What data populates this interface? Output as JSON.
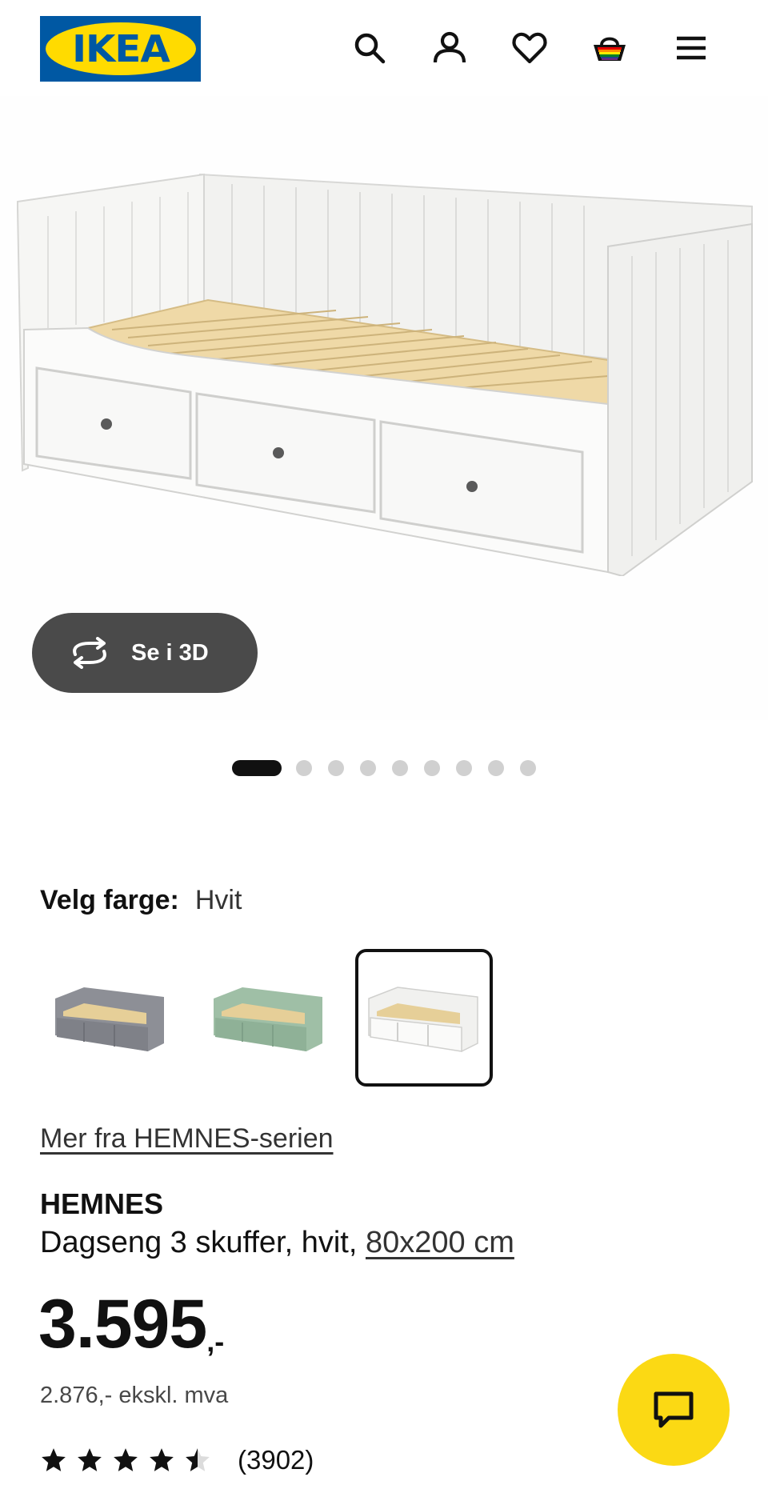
{
  "header": {
    "logo_text": "IKEA",
    "icons": [
      "search-icon",
      "user-icon",
      "heart-icon",
      "basket-icon",
      "menu-icon"
    ]
  },
  "hero": {
    "view_3d_label": "Se i 3D",
    "carousel_total": 9,
    "carousel_active": 1
  },
  "color": {
    "label": "Velg farge:",
    "value": "Hvit",
    "options": [
      {
        "name": "Grå",
        "color": "#8d8f96"
      },
      {
        "name": "Grønn",
        "color": "#9fbfa6"
      },
      {
        "name": "Hvit",
        "color": "#f4f4f2",
        "selected": true
      }
    ]
  },
  "product": {
    "series_link": "Mer fra HEMNES-serien",
    "name": "HEMNES",
    "description": "Dagseng 3 skuffer, hvit,",
    "size": "80x200 cm",
    "price": "3.595",
    "price_suffix": ",-",
    "price_ex_vat": "2.876,- ekskl. mva",
    "rating": 4.5,
    "rating_count": "(3902)"
  },
  "colors": {
    "ikea_blue": "#0058a3",
    "ikea_yellow": "#ffdb00",
    "chat_yellow": "#fbd914",
    "dark_button": "#4a4a4a"
  }
}
